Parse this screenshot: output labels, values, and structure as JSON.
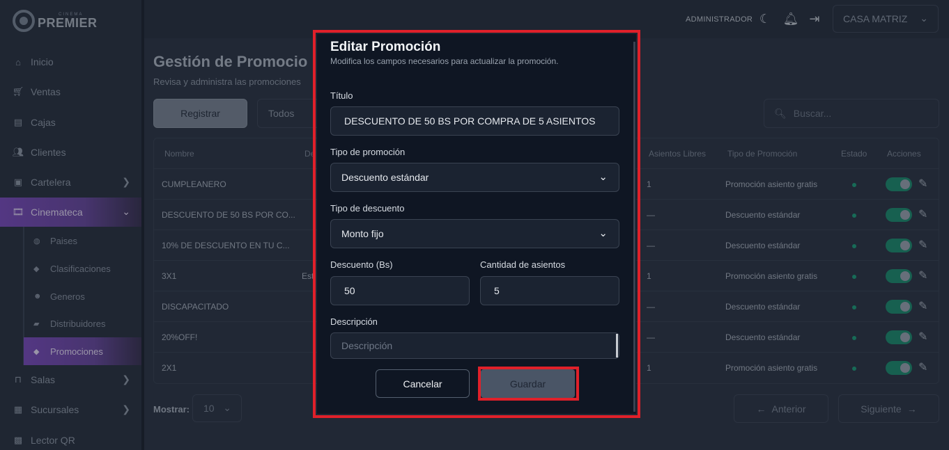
{
  "brand": {
    "small": "CINEMA",
    "big": "PREMIER"
  },
  "sidebar": {
    "items": [
      {
        "label": "Inicio",
        "icon": "home-icon"
      },
      {
        "label": "Ventas",
        "icon": "cart-icon"
      },
      {
        "label": "Cajas",
        "icon": "register-icon"
      },
      {
        "label": "Clientes",
        "icon": "users-icon"
      },
      {
        "label": "Cartelera",
        "icon": "film-board-icon"
      },
      {
        "label": "Cinemateca",
        "icon": "film-icon"
      },
      {
        "label": "Salas",
        "icon": "seat-icon"
      },
      {
        "label": "Sucursales",
        "icon": "store-icon"
      },
      {
        "label": "Lector QR",
        "icon": "qr-icon"
      }
    ],
    "subitems": [
      {
        "label": "Paises",
        "icon": "globe-icon"
      },
      {
        "label": "Clasificaciones",
        "icon": "tag-icon"
      },
      {
        "label": "Generos",
        "icon": "mask-icon"
      },
      {
        "label": "Distribuidores",
        "icon": "truck-icon"
      },
      {
        "label": "Promociones",
        "icon": "tag-icon"
      }
    ]
  },
  "topbar": {
    "role": "ADMINISTRADOR",
    "branch": "CASA MATRIZ"
  },
  "page": {
    "title": "Gestión de Promocio",
    "subtitle": "Revisa y administra las promociones",
    "register_label": "Registrar",
    "filter_value": "Todos",
    "search_placeholder": "Buscar..."
  },
  "table": {
    "headers": {
      "nombre": "Nombre",
      "desc": "De",
      "asientos": "Asientos Libres",
      "tipo": "Tipo de Promoción",
      "estado": "Estado",
      "acciones": "Acciones"
    },
    "rows": [
      {
        "nombre": "CUMPLEANERO",
        "extra": "",
        "asientos": "1",
        "tipo": "Promoción asiento gratis"
      },
      {
        "nombre": "DESCUENTO DE 50 BS POR CO...",
        "extra": "",
        "asientos": "—",
        "tipo": "Descuento estándar"
      },
      {
        "nombre": "10% DE DESCUENTO EN TU C...",
        "extra": "",
        "asientos": "—",
        "tipo": "Descuento estándar"
      },
      {
        "nombre": "3X1",
        "extra": "Est",
        "asientos": "1",
        "tipo": "Promoción asiento gratis"
      },
      {
        "nombre": "DISCAPACITADO",
        "extra": "",
        "asientos": "—",
        "tipo": "Descuento estándar"
      },
      {
        "nombre": "20%OFF!",
        "extra": "",
        "asientos": "—",
        "tipo": "Descuento estándar"
      },
      {
        "nombre": "2X1",
        "extra": "",
        "asientos": "1",
        "tipo": "Promoción asiento gratis"
      }
    ]
  },
  "footer": {
    "mostrar_label": "Mostrar:",
    "page_size": "10",
    "prev": "Anterior",
    "next": "Siguiente"
  },
  "modal": {
    "title": "Editar Promoción",
    "subtitle": "Modifica los campos necesarios para actualizar la promoción.",
    "titulo_label": "Título",
    "titulo_value": "DESCUENTO DE 50 BS POR COMPRA DE 5 ASIENTOS",
    "tipo_promo_label": "Tipo de promoción",
    "tipo_promo_value": "Descuento estándar",
    "tipo_desc_label": "Tipo de descuento",
    "tipo_desc_value": "Monto fijo",
    "descuento_label": "Descuento (Bs)",
    "descuento_value": "50",
    "cantidad_label": "Cantidad de asientos",
    "cantidad_value": "5",
    "descripcion_label": "Descripción",
    "descripcion_placeholder": "Descripción",
    "cancel_label": "Cancelar",
    "save_label": "Guardar"
  },
  "colors": {
    "accent": "#7c4dbd",
    "highlight": "#e0202a",
    "toggle_on": "#1f8c6f"
  }
}
